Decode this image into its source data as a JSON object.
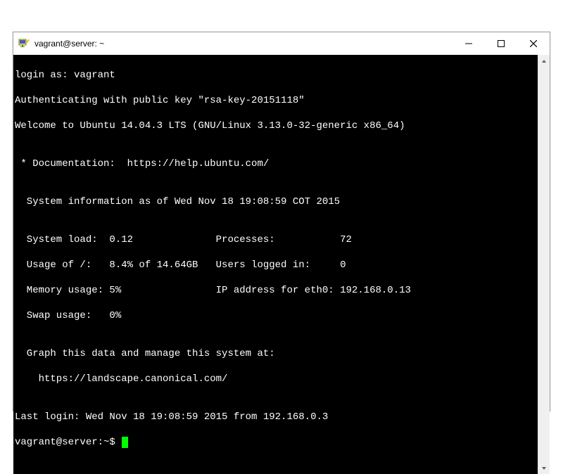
{
  "window": {
    "title": "vagrant@server: ~"
  },
  "term": {
    "l1": "login as: vagrant",
    "l2": "Authenticating with public key \"rsa-key-20151118\"",
    "l3": "Welcome to Ubuntu 14.04.3 LTS (GNU/Linux 3.13.0-32-generic x86_64)",
    "l4": "",
    "l5": " * Documentation:  https://help.ubuntu.com/",
    "l6": "",
    "l7": "  System information as of Wed Nov 18 19:08:59 COT 2015",
    "l8": "",
    "l9": "  System load:  0.12              Processes:           72",
    "l10": "  Usage of /:   8.4% of 14.64GB   Users logged in:     0",
    "l11": "  Memory usage: 5%                IP address for eth0: 192.168.0.13",
    "l12": "  Swap usage:   0%",
    "l13": "",
    "l14": "  Graph this data and manage this system at:",
    "l15": "    https://landscape.canonical.com/",
    "l16": "",
    "l17": "Last login: Wed Nov 18 19:08:59 2015 from 192.168.0.3",
    "prompt": "vagrant@server:~$ "
  }
}
